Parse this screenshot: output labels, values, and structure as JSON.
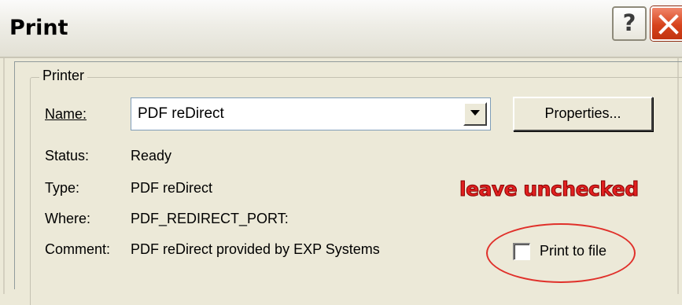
{
  "window": {
    "title": "Print",
    "help_glyph": "?",
    "close_icon": "close-icon"
  },
  "printer_group": {
    "legend": "Printer",
    "name_label": "Name:",
    "name_value": "PDF reDirect",
    "properties_label": "Properties...",
    "status_label": "Status:",
    "status_value": "Ready",
    "type_label": "Type:",
    "type_value": "PDF reDirect",
    "where_label": "Where:",
    "where_value": "PDF_REDIRECT_PORT:",
    "comment_label": "Comment:",
    "comment_value": "PDF reDirect provided by EXP Systems",
    "print_to_file_label": "Print to file",
    "print_to_file_checked": false
  },
  "annotation": {
    "text": "leave unchecked",
    "color": "#e02020"
  },
  "colors": {
    "dialog_bg": "#ece9d8",
    "close_button": "#d7431c",
    "input_border": "#7f9db9"
  }
}
